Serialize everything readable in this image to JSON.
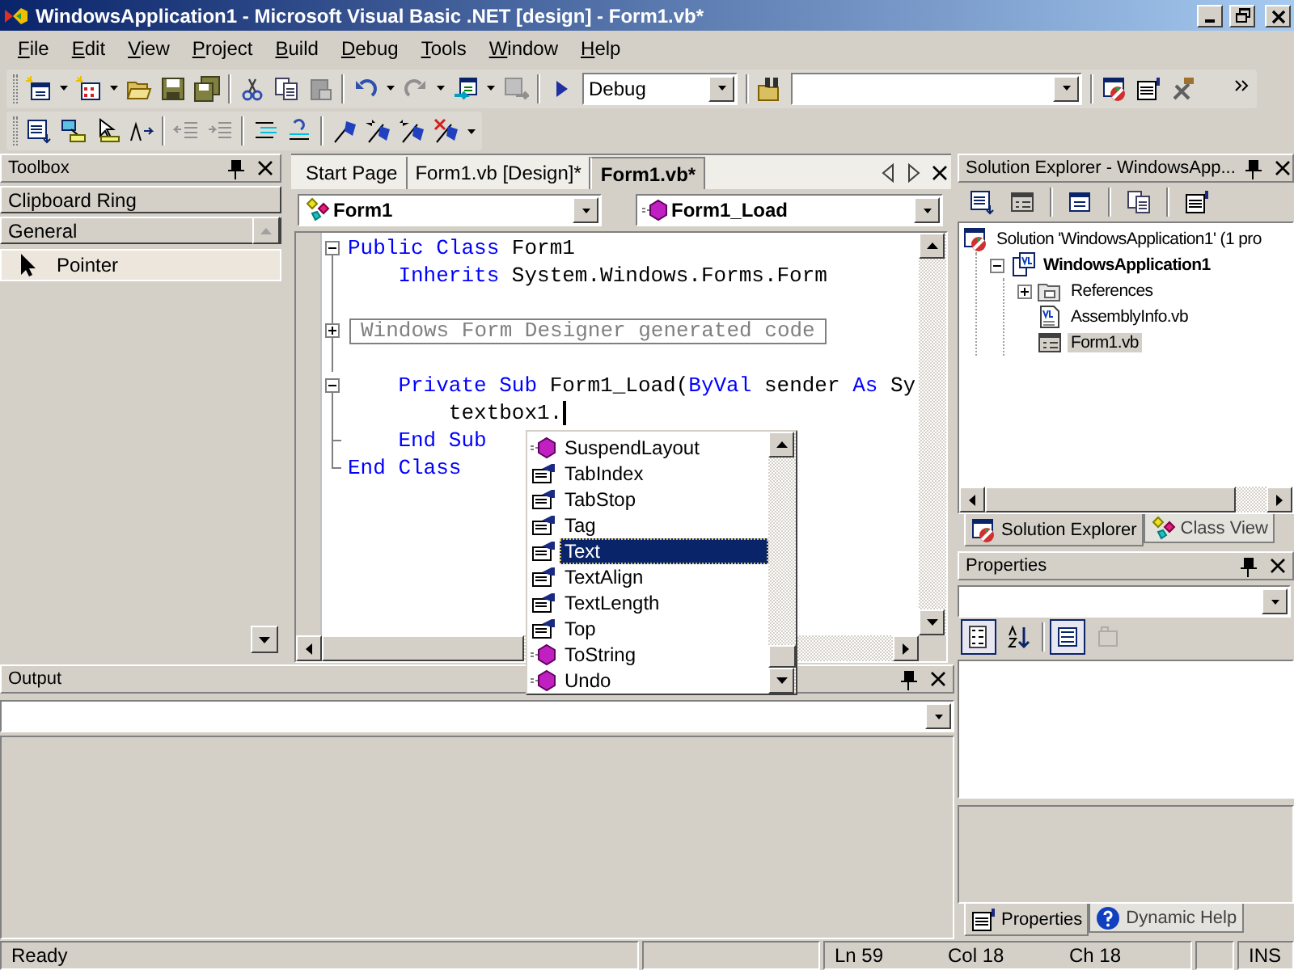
{
  "window": {
    "title": "WindowsApplication1 - Microsoft Visual Basic .NET [design] - Form1.vb*"
  },
  "menu": [
    "File",
    "Edit",
    "View",
    "Project",
    "Build",
    "Debug",
    "Tools",
    "Window",
    "Help"
  ],
  "toolbar": {
    "configuration": "Debug"
  },
  "toolbox": {
    "title": "Toolbox",
    "sections": [
      {
        "label": "Clipboard Ring",
        "expanded": false
      },
      {
        "label": "General",
        "expanded": true,
        "items": [
          {
            "label": "Pointer",
            "selected": true
          }
        ]
      }
    ]
  },
  "editor": {
    "tabs": [
      {
        "label": "Start Page",
        "selected": false
      },
      {
        "label": "Form1.vb [Design]*",
        "selected": false
      },
      {
        "label": "Form1.vb*",
        "selected": true
      }
    ],
    "class_dropdown": "Form1",
    "member_dropdown": "Form1_Load",
    "lines": [
      {
        "kind": "start",
        "caret": false,
        "segments": [
          {
            "text": "Public Class",
            "keyword": true
          },
          {
            "text": " Form1",
            "keyword": false
          }
        ]
      },
      {
        "kind": "line",
        "caret": false,
        "segments": [
          {
            "text": "    Inherits",
            "keyword": true
          },
          {
            "text": " System.Windows.Forms.Form",
            "keyword": false
          }
        ]
      },
      {
        "kind": "line",
        "caret": false
      },
      {
        "kind": "collapsed",
        "caret": false,
        "region": "Windows Form Designer generated code"
      },
      {
        "kind": "line",
        "caret": false
      },
      {
        "kind": "start",
        "caret": false,
        "segments": [
          {
            "text": "    Private Sub",
            "keyword": true
          },
          {
            "text": " Form1_Load(",
            "keyword": false
          },
          {
            "text": "ByVal",
            "keyword": true
          },
          {
            "text": " sender ",
            "keyword": false
          },
          {
            "text": "As",
            "keyword": true
          },
          {
            "text": " Sy",
            "keyword": false
          }
        ]
      },
      {
        "kind": "line",
        "caret": true,
        "segments": [
          {
            "text": "        textbox1.",
            "keyword": false
          }
        ]
      },
      {
        "kind": "branch-end",
        "caret": false,
        "segments": [
          {
            "text": "    End Sub",
            "keyword": true
          }
        ]
      },
      {
        "kind": "end",
        "caret": false,
        "segments": [
          {
            "text": "End Class",
            "keyword": true
          }
        ]
      }
    ],
    "completion": [
      {
        "label": "SuspendLayout",
        "kind": "method",
        "selected": false
      },
      {
        "label": "TabIndex",
        "kind": "property",
        "selected": false
      },
      {
        "label": "TabStop",
        "kind": "property",
        "selected": false
      },
      {
        "label": "Tag",
        "kind": "property",
        "selected": false
      },
      {
        "label": "Text",
        "kind": "property",
        "selected": true
      },
      {
        "label": "TextAlign",
        "kind": "property",
        "selected": false
      },
      {
        "label": "TextLength",
        "kind": "property",
        "selected": false
      },
      {
        "label": "Top",
        "kind": "property",
        "selected": false
      },
      {
        "label": "ToString",
        "kind": "method",
        "selected": false
      },
      {
        "label": "Undo",
        "kind": "method",
        "selected": false
      }
    ]
  },
  "solution_explorer": {
    "title": "Solution Explorer - WindowsApp...",
    "tree": [
      {
        "label": "Solution 'WindowsApplication1' (1 pro",
        "kind": "solution",
        "expanded": true,
        "selected": false,
        "children": [
          {
            "label": "WindowsApplication1",
            "kind": "project",
            "expanded": true,
            "selected": false,
            "children": [
              {
                "label": "References",
                "kind": "references",
                "expanded": false,
                "selected": false
              },
              {
                "label": "AssemblyInfo.vb",
                "kind": "vb-file",
                "selected": false
              },
              {
                "label": "Form1.vb",
                "kind": "form-file",
                "selected": true
              }
            ]
          }
        ]
      }
    ],
    "tabs": [
      {
        "label": "Solution Explorer",
        "selected": true
      },
      {
        "label": "Class View",
        "selected": false
      }
    ]
  },
  "properties": {
    "title": "Properties",
    "toolbar": [
      {
        "kind": "categorized",
        "pressed": true,
        "disabled": false
      },
      {
        "kind": "alphabetical",
        "pressed": false,
        "disabled": false
      },
      {
        "kind": "property-list",
        "pressed": true,
        "disabled": false
      },
      {
        "kind": "property-pages",
        "pressed": false,
        "disabled": true
      }
    ],
    "tabs": [
      {
        "label": "Properties",
        "selected": true
      },
      {
        "label": "Dynamic Help",
        "selected": false
      }
    ]
  },
  "output": {
    "title": "Output"
  },
  "status_bar": {
    "message": "Ready",
    "line": "Ln 59",
    "column": "Col 18",
    "char": "Ch 18",
    "mode": "INS"
  }
}
